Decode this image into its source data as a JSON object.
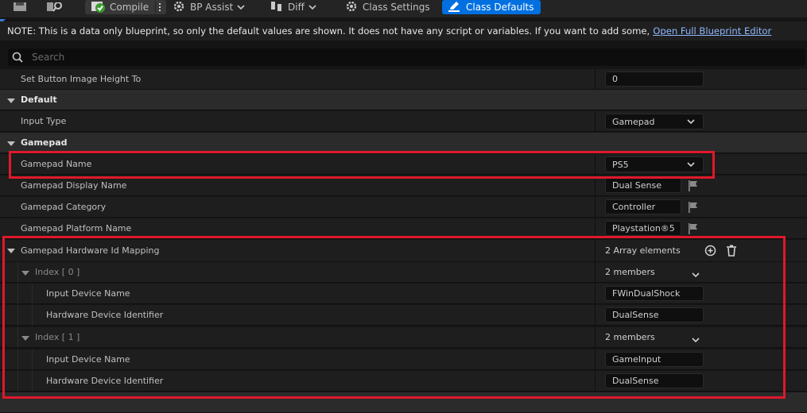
{
  "toolbar": {
    "compile_label": "Compile",
    "bp_assist_label": "BP Assist",
    "diff_label": "Diff",
    "class_settings_label": "Class Settings",
    "class_defaults_label": "Class Defaults"
  },
  "note": {
    "text": "NOTE: This is a data only blueprint, so only the default values are shown.  It does not have any script or variables.  If you want to add some,",
    "link": "Open Full Blueprint Editor"
  },
  "search": {
    "placeholder": "Search"
  },
  "rows": {
    "set_button_image_height": {
      "label": "Set Button Image Height To",
      "value": "0"
    },
    "default_category": {
      "label": "Default"
    },
    "input_type": {
      "label": "Input Type",
      "value": "Gamepad"
    },
    "gamepad_category": {
      "label": "Gamepad"
    },
    "gamepad_name": {
      "label": "Gamepad Name",
      "value": "PS5"
    },
    "gamepad_display_name": {
      "label": "Gamepad Display Name",
      "value": "Dual Sense"
    },
    "gamepad_category_prop": {
      "label": "Gamepad Category",
      "value": "Controller"
    },
    "gamepad_platform_name": {
      "label": "Gamepad Platform Name",
      "value": "Playstation®5"
    },
    "hardware_mapping": {
      "label": "Gamepad Hardware Id Mapping",
      "value": "2 Array elements"
    },
    "index0": {
      "label": "Index [ 0 ]",
      "value": "2 members"
    },
    "index0_input_device": {
      "label": "Input Device Name",
      "value": "FWinDualShock"
    },
    "index0_hw_id": {
      "label": "Hardware Device Identifier",
      "value": "DualSense"
    },
    "index1": {
      "label": "Index [ 1 ]",
      "value": "2 members"
    },
    "index1_input_device": {
      "label": "Input Device Name",
      "value": "GameInput"
    },
    "index1_hw_id": {
      "label": "Hardware Device Identifier",
      "value": "DualSense"
    }
  },
  "colors": {
    "accent": "#0070e0",
    "highlight": "#e0182b",
    "link": "#8fb8ff"
  }
}
